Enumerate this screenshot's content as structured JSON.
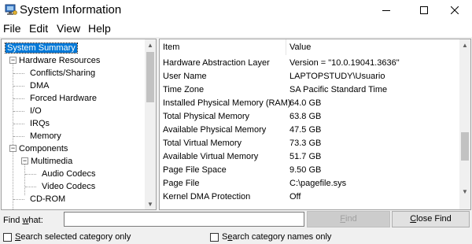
{
  "window": {
    "title": "System Information"
  },
  "menu": {
    "items": [
      "File",
      "Edit",
      "View",
      "Help"
    ]
  },
  "tree": {
    "items": [
      {
        "label": "System Summary",
        "level": 0,
        "expander": "",
        "selected": true
      },
      {
        "label": "Hardware Resources",
        "level": 0,
        "expander": "−",
        "selected": false
      },
      {
        "label": "Conflicts/Sharing",
        "level": 1,
        "expander": "",
        "selected": false
      },
      {
        "label": "DMA",
        "level": 1,
        "expander": "",
        "selected": false
      },
      {
        "label": "Forced Hardware",
        "level": 1,
        "expander": "",
        "selected": false
      },
      {
        "label": "I/O",
        "level": 1,
        "expander": "",
        "selected": false
      },
      {
        "label": "IRQs",
        "level": 1,
        "expander": "",
        "selected": false
      },
      {
        "label": "Memory",
        "level": 1,
        "expander": "",
        "selected": false
      },
      {
        "label": "Components",
        "level": 0,
        "expander": "−",
        "selected": false
      },
      {
        "label": "Multimedia",
        "level": 1,
        "expander": "−",
        "selected": false
      },
      {
        "label": "Audio Codecs",
        "level": 2,
        "expander": "",
        "selected": false
      },
      {
        "label": "Video Codecs",
        "level": 2,
        "expander": "",
        "selected": false
      },
      {
        "label": "CD-ROM",
        "level": 1,
        "expander": "",
        "selected": false
      }
    ]
  },
  "list": {
    "columns": [
      "Item",
      "Value"
    ],
    "rows": [
      {
        "item": "Hardware Abstraction Layer",
        "value": "Version = \"10.0.19041.3636\""
      },
      {
        "item": "User Name",
        "value": "LAPTOPSTUDY\\Usuario"
      },
      {
        "item": "Time Zone",
        "value": "SA Pacific Standard Time"
      },
      {
        "item": "Installed Physical Memory (RAM)",
        "value": "64.0 GB"
      },
      {
        "item": "Total Physical Memory",
        "value": "63.8 GB"
      },
      {
        "item": "Available Physical Memory",
        "value": "47.5 GB"
      },
      {
        "item": "Total Virtual Memory",
        "value": "73.3 GB"
      },
      {
        "item": "Available Virtual Memory",
        "value": "51.7 GB"
      },
      {
        "item": "Page File Space",
        "value": "9.50 GB"
      },
      {
        "item": "Page File",
        "value": "C:\\pagefile.sys"
      },
      {
        "item": "Kernel DMA Protection",
        "value": "Off"
      }
    ]
  },
  "find": {
    "label_pre": "Find ",
    "label_key": "w",
    "label_post": "hat:",
    "value": "",
    "find_btn_key": "F",
    "find_btn_rest": "ind",
    "close_btn_key": "C",
    "close_btn_rest": "lose Find"
  },
  "options": {
    "search_selected_key": "S",
    "search_selected_rest": "earch selected category only",
    "search_names_pre": "S",
    "search_names_key": "e",
    "search_names_rest": "arch category names only"
  }
}
